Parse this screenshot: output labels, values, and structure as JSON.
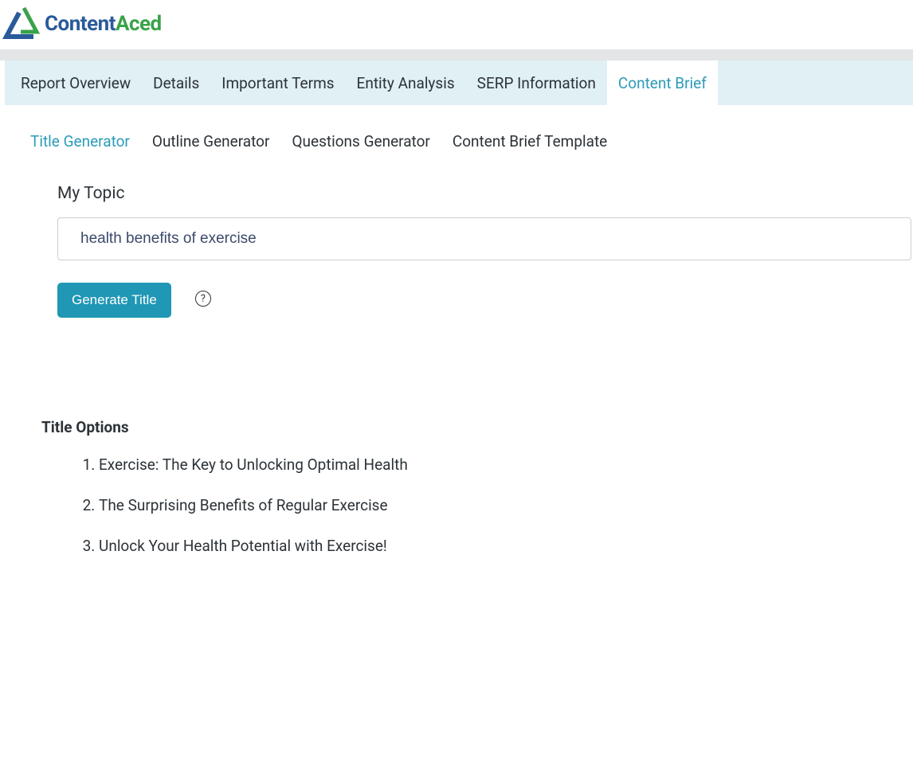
{
  "brand": {
    "part1": "Content",
    "part2": "Aced"
  },
  "mainTabs": [
    {
      "label": "Report Overview",
      "active": false
    },
    {
      "label": "Details",
      "active": false
    },
    {
      "label": "Important Terms",
      "active": false
    },
    {
      "label": "Entity Analysis",
      "active": false
    },
    {
      "label": "SERP Information",
      "active": false
    },
    {
      "label": "Content Brief",
      "active": true
    }
  ],
  "subTabs": [
    {
      "label": "Title Generator",
      "active": true
    },
    {
      "label": "Outline Generator",
      "active": false
    },
    {
      "label": "Questions Generator",
      "active": false
    },
    {
      "label": "Content Brief Template",
      "active": false
    }
  ],
  "topic": {
    "label": "My Topic",
    "value": "health benefits of exercise"
  },
  "generateButton": "Generate Title",
  "helpGlyph": "?",
  "titleOptions": {
    "heading": "Title Options",
    "items": [
      "Exercise: The Key to Unlocking Optimal Health",
      "The Surprising Benefits of Regular Exercise",
      "Unlock Your Health Potential with Exercise!"
    ]
  }
}
